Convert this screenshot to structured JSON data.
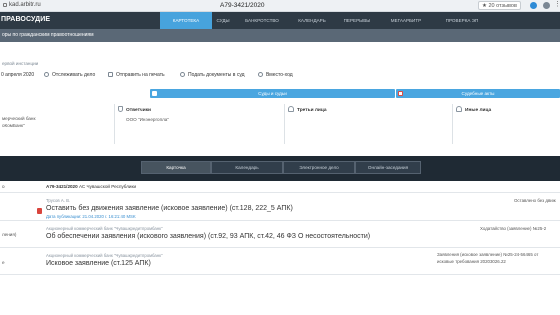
{
  "browser": {
    "address": "kad.arbitr.ru",
    "page_title": "А79-3421/2020",
    "rating": "★ 20 отзывов"
  },
  "header": {
    "logo": "ПРАВОСУДИЕ",
    "nav": [
      {
        "label": "КАРТОТЕКА",
        "active": true
      },
      {
        "label": "СУДЫ",
        "active": false
      },
      {
        "label": "БАНКРОТСТВО",
        "active": false
      },
      {
        "label": "КАЛЕНДАРЬ",
        "active": false
      },
      {
        "label": "ПЕРЕРЫВЫ",
        "active": false
      },
      {
        "label": "МЕГААРБИТР",
        "active": false
      },
      {
        "label": "ПРОВЕРКА ЭП",
        "active": false
      }
    ]
  },
  "subbar": "оры по гражданским правоотношениям",
  "instance_label": "ервой инстанции",
  "toolbar": {
    "date": "0 апреля 2020",
    "items": [
      "Отслеживать дело",
      "Отправить на печать",
      "Подать документы в суд",
      "Вместо-ход"
    ]
  },
  "tabs": {
    "documents": "Суды и судьи",
    "acts": "Судебные акты"
  },
  "parties": {
    "left_values": [
      "мерческий банк",
      "оКомБанк\""
    ],
    "defendants_label": "Ответчики",
    "defendants": [
      "ООО \"Инэнергопла\""
    ],
    "third_label": "Третьи лица",
    "other_label": "Иные лица"
  },
  "segments": [
    "Карточка",
    "Календарь",
    "Электронное дело",
    "Онлайн-заседания"
  ],
  "case": {
    "left": "о",
    "number": "А79-3421/2020",
    "court": "АС Чувашской Республики"
  },
  "events": [
    {
      "who": "Трусов А. В.",
      "title": "Оставить без движения заявление (исковое заявление) (ст.128, 222_5 АПК)",
      "pub": "Дата публикации: 21.04.2020 г. 16:21:40 MSK",
      "right": [
        "Оставлено без движ"
      ],
      "has_pdf": true
    },
    {
      "date": "ления)",
      "who": "Акционерный коммерческий банк \"Чувашкредитпромбанк\"",
      "title": "Об обеспечении заявления (искового заявления) (ст.92, 93 АПК, ст.42, 46 ФЗ О несостоятельности)",
      "right": [
        "Ходатайство (заявление) №25-2"
      ],
      "has_pdf": false
    },
    {
      "date": "е",
      "who": "Акционерный коммерческий банк \"Чувашкредитпромбанк\"",
      "title": "Исковое заявление (ст.125 АПК)",
      "right": [
        "Заявления (исковое заявление) №25-24-56465 от",
        "исковые требования 20203026.22"
      ],
      "has_pdf": false
    }
  ],
  "colors": {
    "header_bg": "#2e3a45",
    "nav_active": "#47a3dd",
    "segment_bar": "#1f2a34",
    "accent_blue": "#4aa6e0",
    "pdf_red": "#d9443c"
  }
}
